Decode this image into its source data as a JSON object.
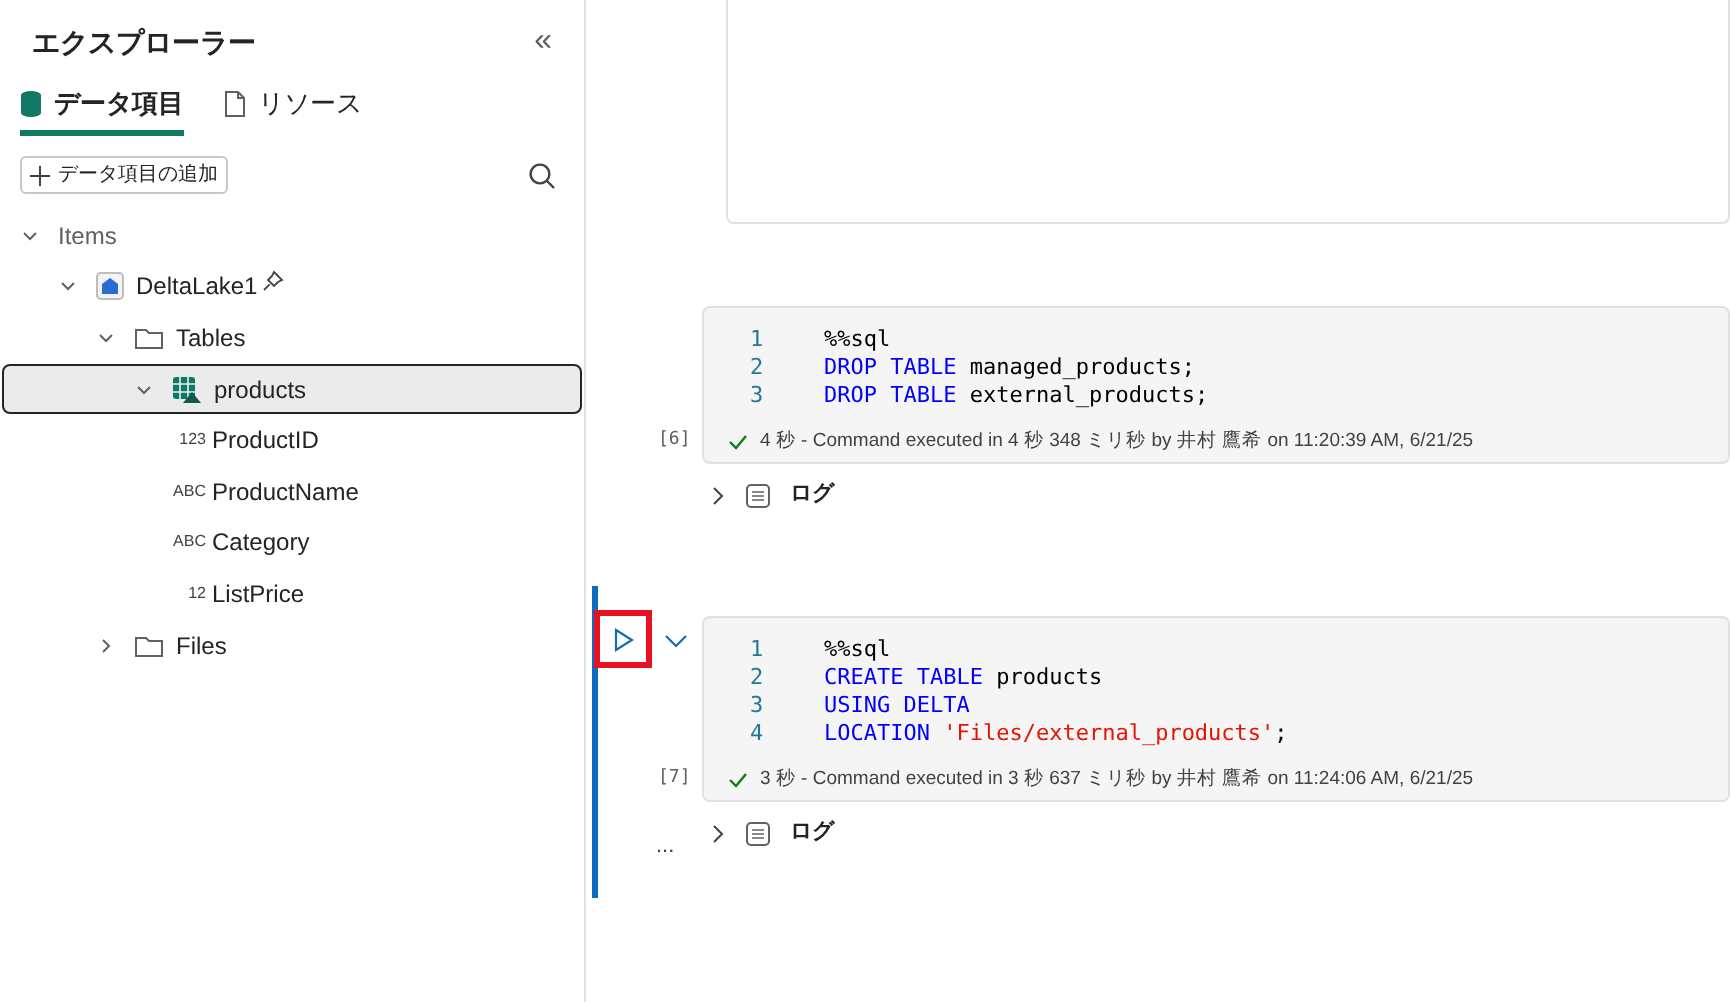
{
  "sidebar": {
    "title": "エクスプローラー",
    "collapse_glyph": "«",
    "tabs": [
      {
        "label": "データ項目",
        "selected": true
      },
      {
        "label": "リソース",
        "selected": false
      }
    ],
    "add_button": "データ項目の追加",
    "tree": [
      {
        "label": "Items",
        "kind": "group",
        "expanded": true,
        "children": [
          {
            "label": "DeltaLake1",
            "kind": "lakehouse",
            "pinned": true,
            "expanded": true,
            "children": [
              {
                "label": "Tables",
                "kind": "folder",
                "expanded": true,
                "children": [
                  {
                    "label": "products",
                    "kind": "table",
                    "expanded": true,
                    "selected": true,
                    "children": [
                      {
                        "label": "ProductID",
                        "kind": "column",
                        "type_label": "123"
                      },
                      {
                        "label": "ProductName",
                        "kind": "column",
                        "type_label": "ABC"
                      },
                      {
                        "label": "Category",
                        "kind": "column",
                        "type_label": "ABC"
                      },
                      {
                        "label": "ListPrice",
                        "kind": "column",
                        "type_label": "12"
                      }
                    ]
                  }
                ]
              },
              {
                "label": "Files",
                "kind": "folder",
                "expanded": false
              }
            ]
          }
        ]
      }
    ]
  },
  "cells": [
    {
      "exec_count": "[6]",
      "active": false,
      "highlighted_run": false,
      "lines": [
        {
          "number": "1",
          "tokens": [
            {
              "kind": "plain",
              "text": "%%sql"
            }
          ]
        },
        {
          "number": "2",
          "tokens": [
            {
              "kind": "keyword",
              "text": "DROP TABLE"
            },
            {
              "kind": "plain",
              "text": " managed_products;"
            }
          ]
        },
        {
          "number": "3",
          "tokens": [
            {
              "kind": "keyword",
              "text": "DROP TABLE"
            },
            {
              "kind": "plain",
              "text": " external_products;"
            }
          ]
        }
      ],
      "status": "4 秒 - Command executed in 4 秒 348 ミリ秒 by 井村 鷹希 on 11:20:39 AM, 6/21/25",
      "log_label": "ログ"
    },
    {
      "exec_count": "[7]",
      "active": true,
      "highlighted_run": true,
      "lines": [
        {
          "number": "1",
          "tokens": [
            {
              "kind": "plain",
              "text": "%%sql"
            }
          ]
        },
        {
          "number": "2",
          "tokens": [
            {
              "kind": "keyword",
              "text": "CREATE TABLE"
            },
            {
              "kind": "plain",
              "text": " products"
            }
          ]
        },
        {
          "number": "3",
          "tokens": [
            {
              "kind": "keyword",
              "text": "USING DELTA"
            }
          ]
        },
        {
          "number": "4",
          "tokens": [
            {
              "kind": "keyword",
              "text": "LOCATION"
            },
            {
              "kind": "string",
              "text": " 'Files/external_products'"
            },
            {
              "kind": "plain",
              "text": ";"
            }
          ]
        }
      ],
      "status": "3 秒 - Command executed in 3 秒 637 ミリ秒 by 井村 鷹希 on 11:24:06 AM, 6/21/25",
      "log_label": "ログ",
      "more": "..."
    }
  ]
}
